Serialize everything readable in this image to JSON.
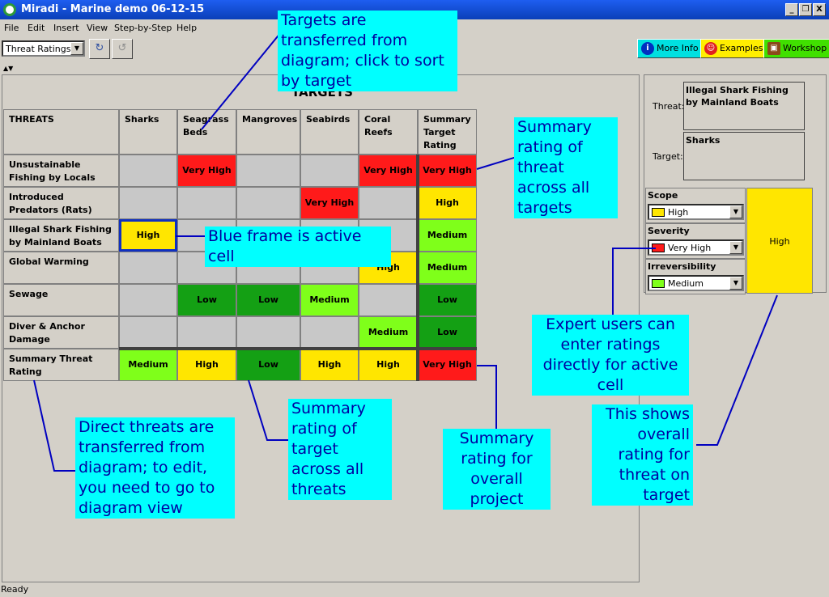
{
  "window": {
    "title": "Miradi - Marine demo 06-12-15",
    "minimize": "_",
    "restore": "❐",
    "close": "X"
  },
  "menu": [
    "File",
    "Edit",
    "Insert",
    "View",
    "Step-by-Step",
    "Help"
  ],
  "toolbar": {
    "view_select": "Threat Ratings",
    "more_info": "More Info",
    "examples": "Examples",
    "workshop": "Workshop"
  },
  "table": {
    "heading": "TARGETS",
    "corner": "THREATS",
    "columns": [
      "Sharks",
      "Seagrass Beds",
      "Mangroves",
      "Seabirds",
      "Coral Reefs",
      "Summary Target Rating"
    ],
    "rows": [
      {
        "threat": "Unsustainable Fishing by Locals",
        "cells": [
          "",
          "Very High",
          "",
          "",
          "Very High",
          "Very High"
        ]
      },
      {
        "threat": "Introduced Predators (Rats)",
        "cells": [
          "",
          "",
          "",
          "Very High",
          "",
          "High"
        ]
      },
      {
        "threat": "Illegal Shark Fishing by Mainland Boats",
        "cells": [
          "High",
          "",
          "",
          "",
          "",
          "Medium"
        ]
      },
      {
        "threat": "Global Warming",
        "cells": [
          "",
          "",
          "",
          "",
          "High",
          "Medium"
        ]
      },
      {
        "threat": "Sewage",
        "cells": [
          "",
          "Low",
          "Low",
          "Medium",
          "",
          "Low"
        ]
      },
      {
        "threat": "Diver & Anchor Damage",
        "cells": [
          "",
          "",
          "",
          "",
          "Medium",
          "Low"
        ]
      },
      {
        "threat": "Summary Threat Rating",
        "cells": [
          "Medium",
          "High",
          "Low",
          "High",
          "High",
          "Very High"
        ]
      }
    ]
  },
  "colors": {
    "Very High": "#ff1a1a",
    "High": "#ffe600",
    "Medium": "#7fff1a",
    "Low": "#14a014",
    "": "#c8c8c8",
    "active_frame": "#1030c0"
  },
  "details": {
    "threat_label": "Threat:",
    "threat_value": "Illegal Shark Fishing by Mainland Boats",
    "target_label": "Target:",
    "target_value": "Sharks",
    "scope_label": "Scope",
    "scope_value": "High",
    "severity_label": "Severity",
    "severity_value": "Very High",
    "irreversibility_label": "Irreversibility",
    "irreversibility_value": "Medium",
    "overall": "High"
  },
  "callouts": {
    "targets": "Targets are transferred from diagram; click to sort by target",
    "summary_threat": "Summary rating of threat across all targets",
    "active": "Blue frame is active cell",
    "expert": "Expert users can enter ratings directly for active cell",
    "direct": "Direct threats are transferred from diagram; to edit, you need to go to diagram view",
    "summary_target": "Summary rating of target across all threats",
    "overall": "Summary rating for overall project",
    "shows": "This shows overall rating for threat on target"
  },
  "status": "Ready"
}
